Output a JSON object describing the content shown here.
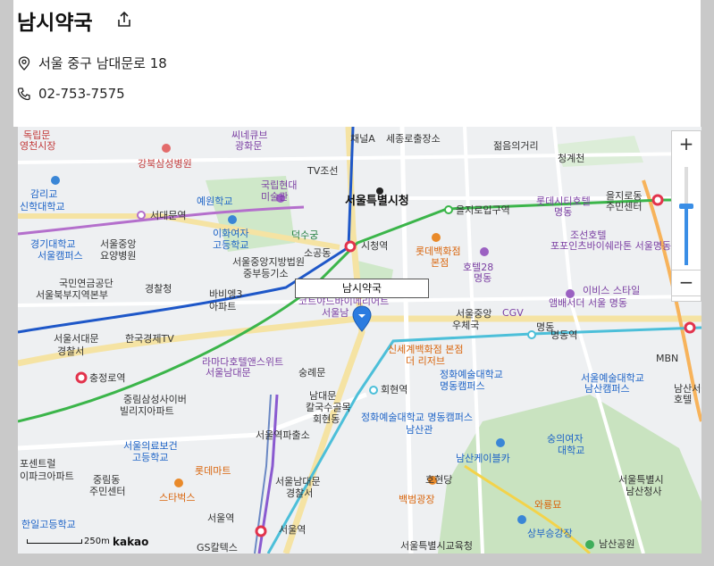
{
  "place": {
    "name": "남시약국",
    "address": "서울 중구 남대문로 18",
    "phone": "02-753-7575"
  },
  "map": {
    "marker_label": "남시약국",
    "zoom_in_label": "+",
    "zoom_out_label": "−",
    "zoom_level_fraction": 0.6,
    "scale_label": "250m",
    "provider": "kakao",
    "labels": [
      {
        "text": "독립문",
        "cls": "red"
      },
      {
        "text": "영천시장",
        "cls": "red"
      },
      {
        "text": "강북삼성병원",
        "cls": "red"
      },
      {
        "text": "씨네큐브",
        "cls": "purple"
      },
      {
        "text": "광화문",
        "cls": "purple"
      },
      {
        "text": "채널A",
        "cls": "dark"
      },
      {
        "text": "세종로출장소",
        "cls": "dark"
      },
      {
        "text": "젊음의거리",
        "cls": "dark"
      },
      {
        "text": "청계천",
        "cls": "dark"
      },
      {
        "text": "감리교",
        "cls": "blue"
      },
      {
        "text": "신학대학교",
        "cls": "blue"
      },
      {
        "text": "예원학교",
        "cls": "blue"
      },
      {
        "text": "국립현대",
        "cls": "purple"
      },
      {
        "text": "미술관",
        "cls": "purple"
      },
      {
        "text": "TV조선",
        "cls": "dark"
      },
      {
        "text": "서울특별시청",
        "cls": "bold"
      },
      {
        "text": "을지로입구역",
        "cls": "dark"
      },
      {
        "text": "롯데시티호텔",
        "cls": "purple"
      },
      {
        "text": "명동",
        "cls": "purple"
      },
      {
        "text": "을지로동",
        "cls": "dark"
      },
      {
        "text": "주민센터",
        "cls": "dark"
      },
      {
        "text": "서대문역",
        "cls": "dark"
      },
      {
        "text": "이화여자",
        "cls": "blue"
      },
      {
        "text": "고등학교",
        "cls": "blue"
      },
      {
        "text": "덕수궁",
        "cls": "green"
      },
      {
        "text": "조선호텔",
        "cls": "purple"
      },
      {
        "text": "포포인츠바이쉐라톤 서울명동",
        "cls": "purple"
      },
      {
        "text": "경기대학교",
        "cls": "blue"
      },
      {
        "text": "서울캠퍼스",
        "cls": "blue"
      },
      {
        "text": "서울중앙",
        "cls": "dark"
      },
      {
        "text": "요양병원",
        "cls": "dark"
      },
      {
        "text": "소공동",
        "cls": "dark"
      },
      {
        "text": "시청역",
        "cls": "dark"
      },
      {
        "text": "롯데백화점",
        "cls": "orange"
      },
      {
        "text": "본점",
        "cls": "orange"
      },
      {
        "text": "서울중앙지방법원",
        "cls": "dark"
      },
      {
        "text": "중부등기소",
        "cls": "dark"
      },
      {
        "text": "호텔28",
        "cls": "purple"
      },
      {
        "text": "명동",
        "cls": "purple"
      },
      {
        "text": "국민연금공단",
        "cls": "dark"
      },
      {
        "text": "서울북부지역본부",
        "cls": "dark"
      },
      {
        "text": "경찰청",
        "cls": "dark"
      },
      {
        "text": "바비엥3",
        "cls": "dark"
      },
      {
        "text": "아파트",
        "cls": "dark"
      },
      {
        "text": "이비스 스타일",
        "cls": "purple"
      },
      {
        "text": "앰배서더 서울 명동",
        "cls": "purple"
      },
      {
        "text": "코트야드바이메리어트",
        "cls": "purple"
      },
      {
        "text": "서울남",
        "cls": "purple"
      },
      {
        "text": "서울중앙",
        "cls": "dark"
      },
      {
        "text": "우체국",
        "cls": "dark"
      },
      {
        "text": "CGV",
        "cls": "purple"
      },
      {
        "text": "명동",
        "cls": "dark"
      },
      {
        "text": "명동역",
        "cls": "dark"
      },
      {
        "text": "서울서대문",
        "cls": "dark"
      },
      {
        "text": "경찰서",
        "cls": "dark"
      },
      {
        "text": "한국경제TV",
        "cls": "dark"
      },
      {
        "text": "신세계백화점 본점",
        "cls": "orange"
      },
      {
        "text": "더 리저브",
        "cls": "orange"
      },
      {
        "text": "MBN",
        "cls": "dark"
      },
      {
        "text": "라마다호텔앤스위트",
        "cls": "purple"
      },
      {
        "text": "서울남대문",
        "cls": "purple"
      },
      {
        "text": "숭례문",
        "cls": "dark"
      },
      {
        "text": "정화예술대학교",
        "cls": "blue"
      },
      {
        "text": "명동캠퍼스",
        "cls": "blue"
      },
      {
        "text": "서울예술대학교",
        "cls": "blue"
      },
      {
        "text": "남산캠퍼스",
        "cls": "blue"
      },
      {
        "text": "충정로역",
        "cls": "dark"
      },
      {
        "text": "남대문",
        "cls": "dark"
      },
      {
        "text": "칼국수골목",
        "cls": "dark"
      },
      {
        "text": "회현역",
        "cls": "dark"
      },
      {
        "text": "중림삼성사이버",
        "cls": "dark"
      },
      {
        "text": "빌리지아파트",
        "cls": "dark"
      },
      {
        "text": "회현동",
        "cls": "dark"
      },
      {
        "text": "정화예술대학교 명동캠퍼스",
        "cls": "blue"
      },
      {
        "text": "남산관",
        "cls": "blue"
      },
      {
        "text": "서울역파출소",
        "cls": "dark"
      },
      {
        "text": "숭의여자",
        "cls": "blue"
      },
      {
        "text": "대학교",
        "cls": "blue"
      },
      {
        "text": "서울의료보건",
        "cls": "blue"
      },
      {
        "text": "고등학교",
        "cls": "blue"
      },
      {
        "text": "남산케이블카",
        "cls": "blue"
      },
      {
        "text": "롯데마트",
        "cls": "orange"
      },
      {
        "text": "포센트럴",
        "cls": "dark"
      },
      {
        "text": "이파크아파트",
        "cls": "dark"
      },
      {
        "text": "중림동",
        "cls": "dark"
      },
      {
        "text": "주민센터",
        "cls": "dark"
      },
      {
        "text": "스타벅스",
        "cls": "orange"
      },
      {
        "text": "서울남대문",
        "cls": "dark"
      },
      {
        "text": "경찰서",
        "cls": "dark"
      },
      {
        "text": "호현당",
        "cls": "dark"
      },
      {
        "text": "백범광장",
        "cls": "orange"
      },
      {
        "text": "서울특별시",
        "cls": "dark"
      },
      {
        "text": "남산청사",
        "cls": "dark"
      },
      {
        "text": "와룡묘",
        "cls": "orange"
      },
      {
        "text": "서울역",
        "cls": "dark"
      },
      {
        "text": "한일고등학교",
        "cls": "blue"
      },
      {
        "text": "서울역",
        "cls": "dark"
      },
      {
        "text": "GS칼텍스",
        "cls": "dark"
      },
      {
        "text": "서울특별시교육청",
        "cls": "dark"
      },
      {
        "text": "상부승강장",
        "cls": "blue"
      },
      {
        "text": "남산공원",
        "cls": "dark"
      },
      {
        "text": "남산서울",
        "cls": "dark"
      },
      {
        "text": "호텔",
        "cls": "dark"
      }
    ]
  }
}
